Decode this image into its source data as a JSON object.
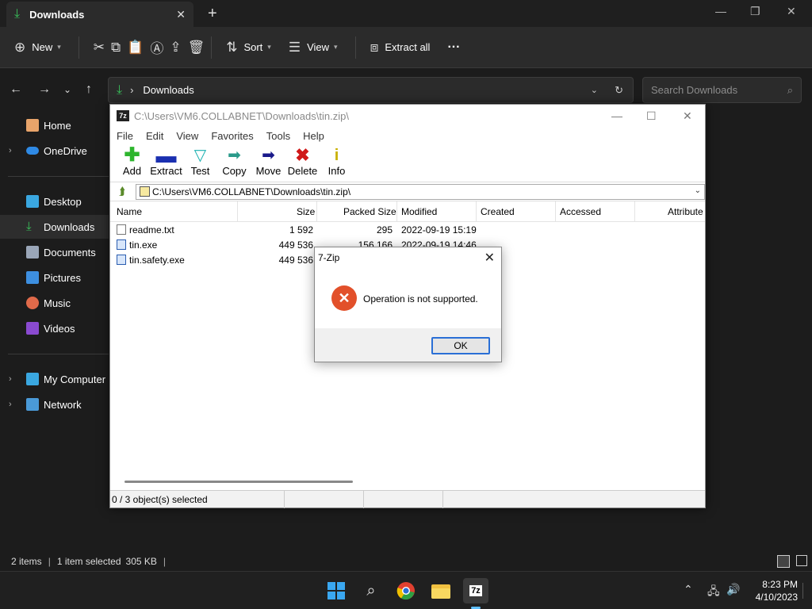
{
  "explorer": {
    "tab_title": "Downloads",
    "toolbar": {
      "new": "New",
      "sort": "Sort",
      "view": "View",
      "extract_all": "Extract all",
      "more": "···"
    },
    "address": "Downloads",
    "search_placeholder": "Search Downloads",
    "sidebar": {
      "items": [
        {
          "label": "Home"
        },
        {
          "label": "OneDrive"
        },
        {
          "label": "Desktop"
        },
        {
          "label": "Downloads"
        },
        {
          "label": "Documents"
        },
        {
          "label": "Pictures"
        },
        {
          "label": "Music"
        },
        {
          "label": "Videos"
        },
        {
          "label": "My Computer"
        },
        {
          "label": "Network"
        }
      ]
    },
    "status": {
      "items": "2 items",
      "selected": "1 item selected",
      "size": "305 KB"
    }
  },
  "sevenzip": {
    "title": "C:\\Users\\VM6.COLLABNET\\Downloads\\tin.zip\\",
    "menu": [
      "File",
      "Edit",
      "View",
      "Favorites",
      "Tools",
      "Help"
    ],
    "tools": [
      {
        "label": "Add"
      },
      {
        "label": "Extract"
      },
      {
        "label": "Test"
      },
      {
        "label": "Copy"
      },
      {
        "label": "Move"
      },
      {
        "label": "Delete"
      },
      {
        "label": "Info"
      }
    ],
    "path": "C:\\Users\\VM6.COLLABNET\\Downloads\\tin.zip\\",
    "columns": [
      "Name",
      "Size",
      "Packed Size",
      "Modified",
      "Created",
      "Accessed",
      "Attribute"
    ],
    "rows": [
      {
        "name": "readme.txt",
        "size": "1 592",
        "packed": "295",
        "modified": "2022-09-19 15:19"
      },
      {
        "name": "tin.exe",
        "size": "449 536",
        "packed": "156 166",
        "modified": "2022-09-19 14:46"
      },
      {
        "name": "tin.safety.exe",
        "size": "449 536",
        "packed": "",
        "modified": ""
      }
    ],
    "status": "0 / 3 object(s) selected"
  },
  "dialog": {
    "title": "7-Zip",
    "message": "Operation is not supported.",
    "ok": "OK"
  },
  "taskbar": {
    "time": "8:23 PM",
    "date": "4/10/2023"
  }
}
